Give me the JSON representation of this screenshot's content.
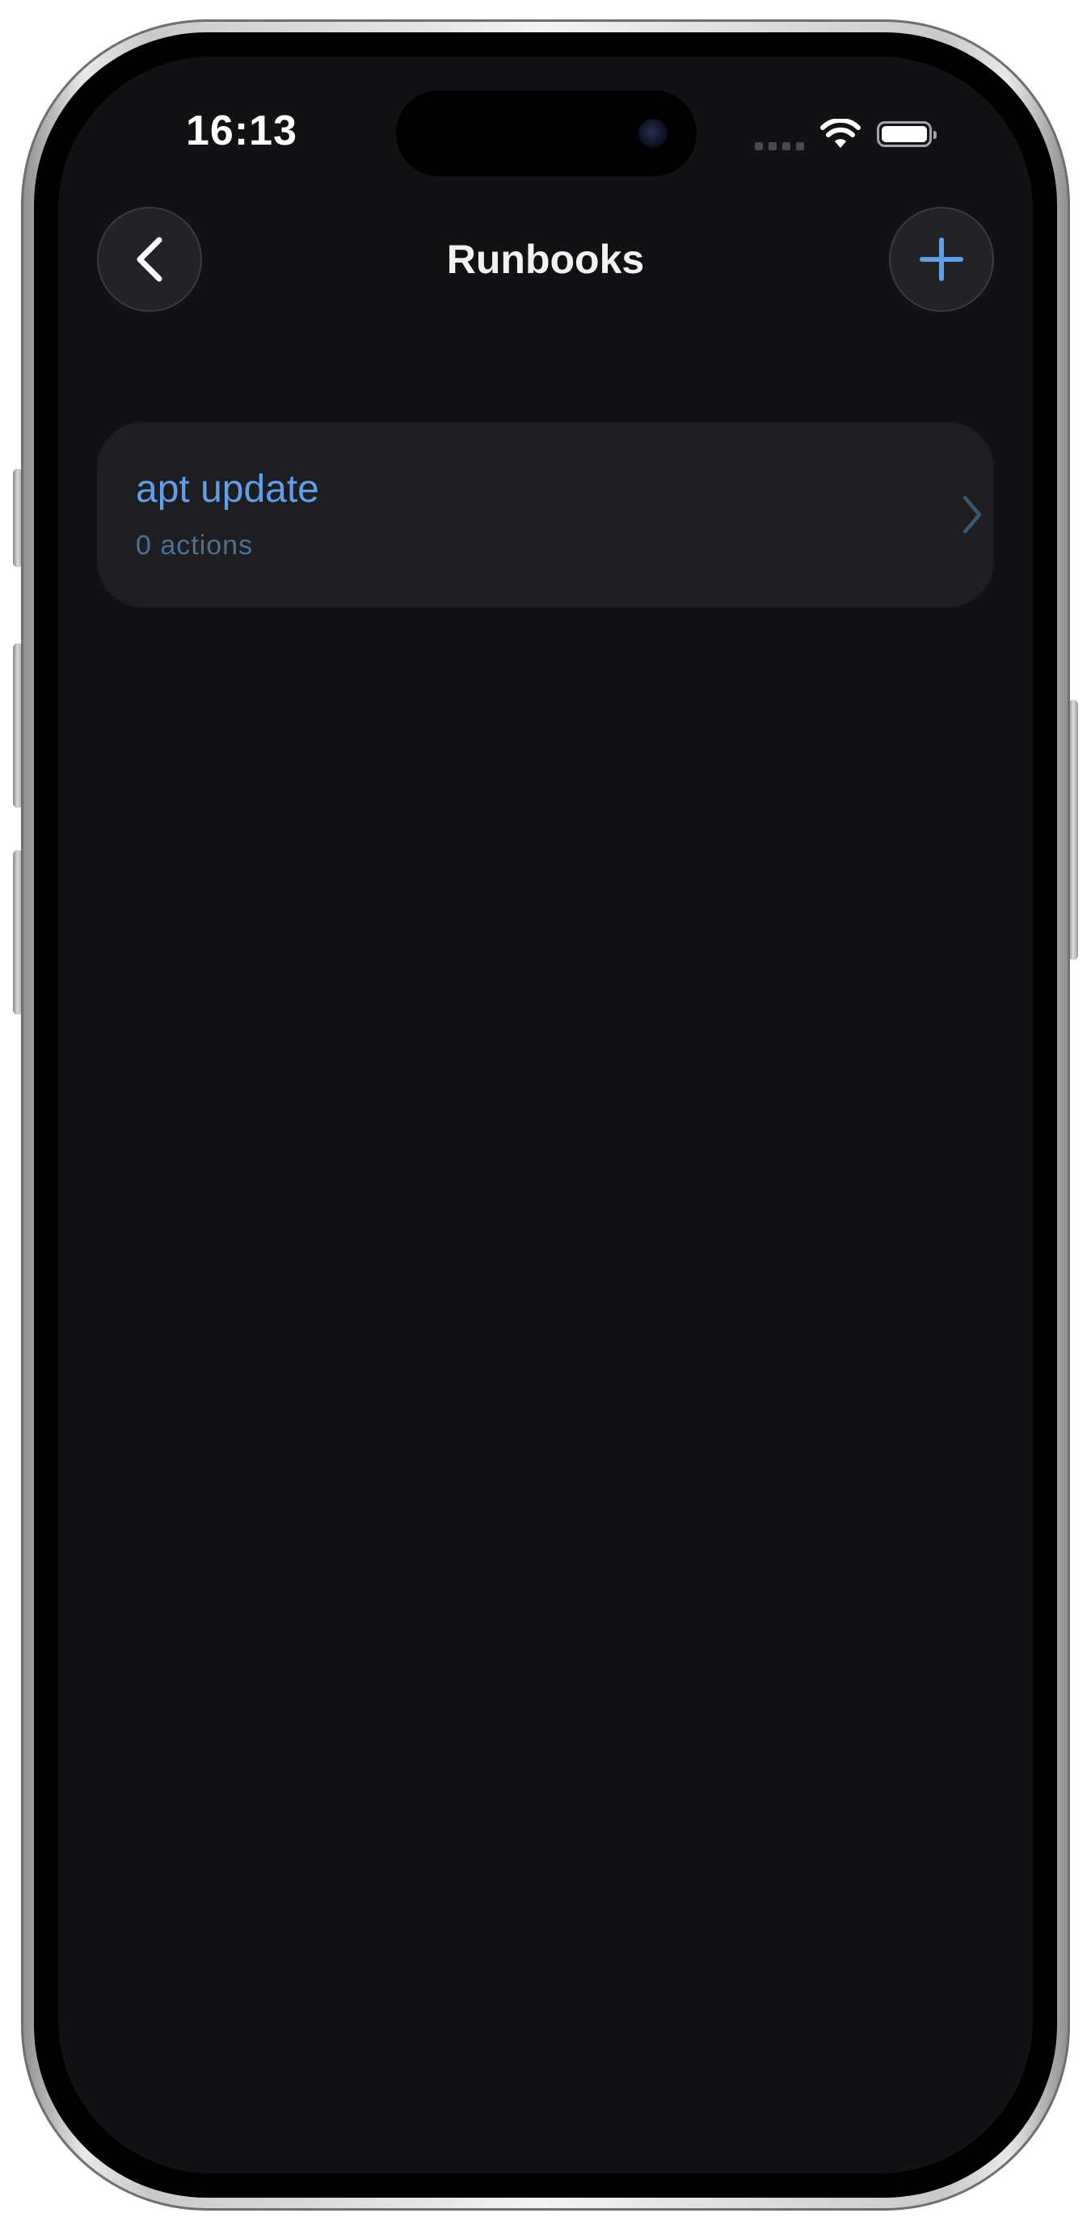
{
  "status_bar": {
    "time": "16:13"
  },
  "navigation": {
    "title": "Runbooks",
    "back_icon": "chevron-left-icon",
    "add_icon": "plus-icon"
  },
  "runbooks": {
    "items": [
      {
        "title": "apt update",
        "subtitle": "0 actions"
      }
    ]
  },
  "colors": {
    "background": "#121214",
    "card": "#1e1e21",
    "accent": "#5e9fe8",
    "secondary_text": "#4f6f92",
    "title_text": "#f2f2f2"
  }
}
